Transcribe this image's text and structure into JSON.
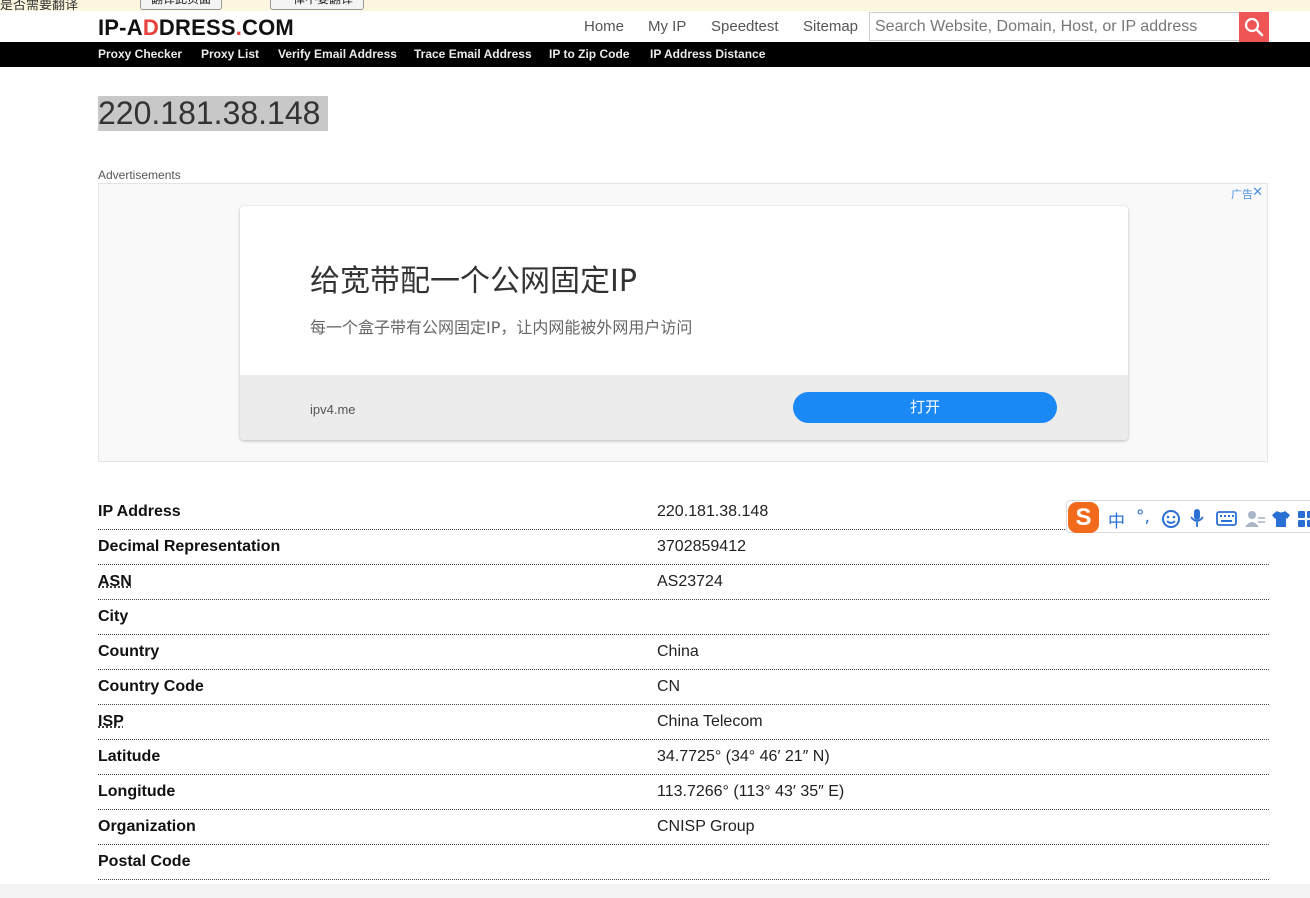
{
  "translation_bar": {
    "text": "是否需要翻译",
    "button_1": "翻译此页面",
    "button_2": "一律不要翻译"
  },
  "header": {
    "logo_part1": "IP-A",
    "logo_part2": "D",
    "logo_part3": "DRESS",
    "logo_part4": ".",
    "logo_part5": "COM",
    "nav": [
      "Home",
      "My IP",
      "Speedtest",
      "Sitemap"
    ],
    "search_placeholder": "Search Website, Domain, Host, or IP address"
  },
  "subnav": [
    "Proxy Checker",
    "Proxy List",
    "Verify Email Address",
    "Trace Email Address",
    "IP to Zip Code",
    "IP Address Distance"
  ],
  "ip_title": "220.181.38.148",
  "ads": {
    "label": "Advertisements",
    "mark": "广告",
    "close": "✕",
    "headline": "给宽带配一个公网固定IP",
    "subline": "每一个盒子带有公网固定IP，让内网能被外网用户访问",
    "domain": "ipv4.me",
    "button": "打开"
  },
  "info": [
    {
      "key": "IP Address",
      "value": "220.181.38.148"
    },
    {
      "key": "Decimal Representation",
      "value": "3702859412"
    },
    {
      "key": "ASN",
      "value": "AS23724"
    },
    {
      "key": "City",
      "value": ""
    },
    {
      "key": "Country",
      "value": "China"
    },
    {
      "key": "Country Code",
      "value": "CN"
    },
    {
      "key": "ISP",
      "value": "China Telecom"
    },
    {
      "key": "Latitude",
      "value": "34.7725° (34° 46′ 21″ N)"
    },
    {
      "key": "Longitude",
      "value": "113.7266° (113° 43′ 35″ E)"
    },
    {
      "key": "Organization",
      "value": "CNISP Group"
    },
    {
      "key": "Postal Code",
      "value": ""
    }
  ],
  "ime": {
    "logo": "S",
    "mode": "中",
    "punct": "°,"
  },
  "colors": {
    "accent": "#e8403a",
    "search_button": "#f05555",
    "ad_button": "#1a88f5",
    "subnav_bg": "#000000"
  }
}
